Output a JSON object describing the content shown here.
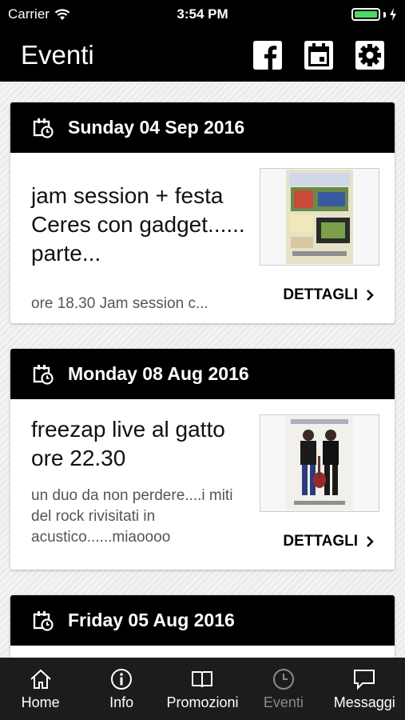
{
  "status_bar": {
    "carrier": "Carrier",
    "time": "3:54 PM",
    "battery_level": 1.0
  },
  "header": {
    "title": "Eventi",
    "icons": [
      "facebook-icon",
      "calendar-icon",
      "gear-icon"
    ]
  },
  "events": [
    {
      "date": "Sunday 04 Sep 2016",
      "title": "jam session + festa Ceres con gadget...... parte...",
      "description": "ore 18.30 Jam session c...",
      "details_label": "DETTAGLI"
    },
    {
      "date": "Monday 08 Aug 2016",
      "title": "freezap live al gatto ore 22.30",
      "description": "un duo da non perdere....i miti del rock rivisitati in acustico......miaoooo",
      "details_label": "DETTAGLI"
    },
    {
      "date": "Friday 05 Aug 2016",
      "title": "",
      "description": "",
      "details_label": ""
    }
  ],
  "tabs": [
    {
      "label": "Home",
      "icon": "home-icon",
      "active": true
    },
    {
      "label": "Info",
      "icon": "info-icon",
      "active": true
    },
    {
      "label": "Promozioni",
      "icon": "book-icon",
      "active": true
    },
    {
      "label": "Eventi",
      "icon": "clock-icon",
      "active": false
    },
    {
      "label": "Messaggi",
      "icon": "chat-icon",
      "active": true
    }
  ],
  "colors": {
    "header_bg": "#000000",
    "card_header_bg": "#000000",
    "tab_bar_bg": "#1c1c1c",
    "tab_inactive": "#8a8a8a",
    "battery": "#4cd964"
  }
}
